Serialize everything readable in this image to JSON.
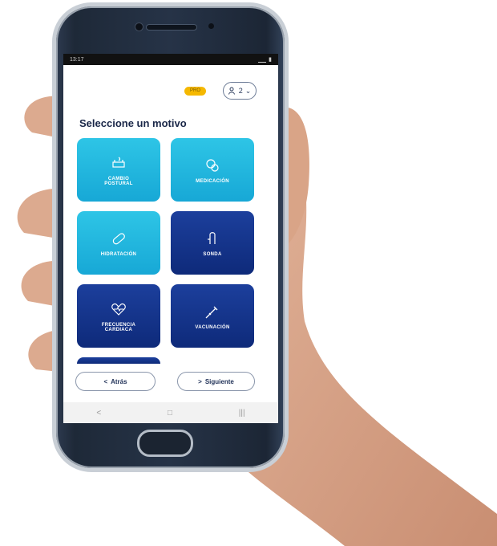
{
  "status_bar": {
    "time": "13:17",
    "battery": "▮"
  },
  "header": {
    "badge_text": "PRO",
    "user_count": "2",
    "user_chevron": "⌄"
  },
  "page": {
    "title": "Seleccione un motivo"
  },
  "reasons": [
    {
      "label": "CAMBIO\nPOSTURAL",
      "icon": "bed-icon",
      "style": "light"
    },
    {
      "label": "MEDICACIÓN",
      "icon": "pills-icon",
      "style": "light"
    },
    {
      "label": "HIDRATACIÓN",
      "icon": "capsule-icon",
      "style": "light"
    },
    {
      "label": "SONDA",
      "icon": "tube-icon",
      "style": "dark"
    },
    {
      "label": "FRECUENCIA\nCARDIACA",
      "icon": "heart-icon",
      "style": "dark"
    },
    {
      "label": "VACUNACIÓN",
      "icon": "syringe-icon",
      "style": "dark"
    }
  ],
  "actions": {
    "back": "Atrás",
    "back_arrow": "<",
    "next": "Siguiente",
    "next_arrow": ">"
  },
  "nav": {
    "back": "<",
    "home": "□",
    "recent": "|||"
  },
  "colors": {
    "light_tile": "#17a8d6",
    "dark_tile": "#0e2a7a",
    "title": "#1a2748",
    "badge": "#f5b800"
  }
}
